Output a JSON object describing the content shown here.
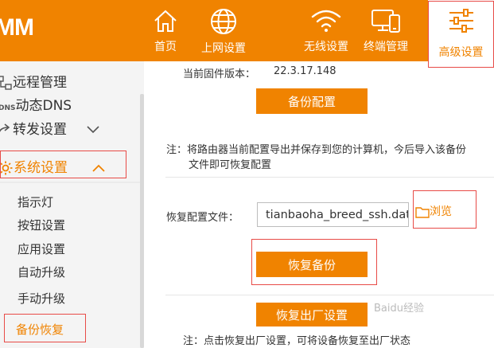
{
  "logo": "MM",
  "nav": [
    {
      "label": "首页",
      "icon": "home-icon"
    },
    {
      "label": "上网设置",
      "icon": "globe-icon"
    },
    {
      "label": "无线设置",
      "icon": "wifi-icon"
    },
    {
      "label": "终端管理",
      "icon": "devices-icon"
    },
    {
      "label": "高级设置",
      "icon": "sliders-icon"
    }
  ],
  "sidebar": {
    "remote": "远程管理",
    "ddns_badge": "DNS",
    "ddns": "动态DNS",
    "forward": "转发设置",
    "system": "系统设置",
    "subs": [
      "指示灯",
      "按钮设置",
      "应用设置",
      "自动升级",
      "手动升级",
      "备份恢复"
    ]
  },
  "main": {
    "firmware_label": "当前固件版本：",
    "firmware_version": "22.3.17.148",
    "backup_button": "备份配置",
    "backup_note_1": "注：将路由器当前配置导出并保存到您的计算机，今后导入该备份",
    "backup_note_2": "文件即可恢复配置",
    "restore_label": "恢复配置文件：",
    "restore_file": "tianbaoha_breed_ssh.dat",
    "browse": "浏览",
    "restore_button": "恢复备份",
    "factory_button": "恢复出厂设置",
    "factory_note": "注：点击恢复出厂设置，可将设备恢复至出厂状态"
  },
  "watermark": "Baidu经验",
  "colors": {
    "accent": "#f08300",
    "highlight": "#e84b47",
    "sidebar_bg": "#f4f4f4"
  }
}
